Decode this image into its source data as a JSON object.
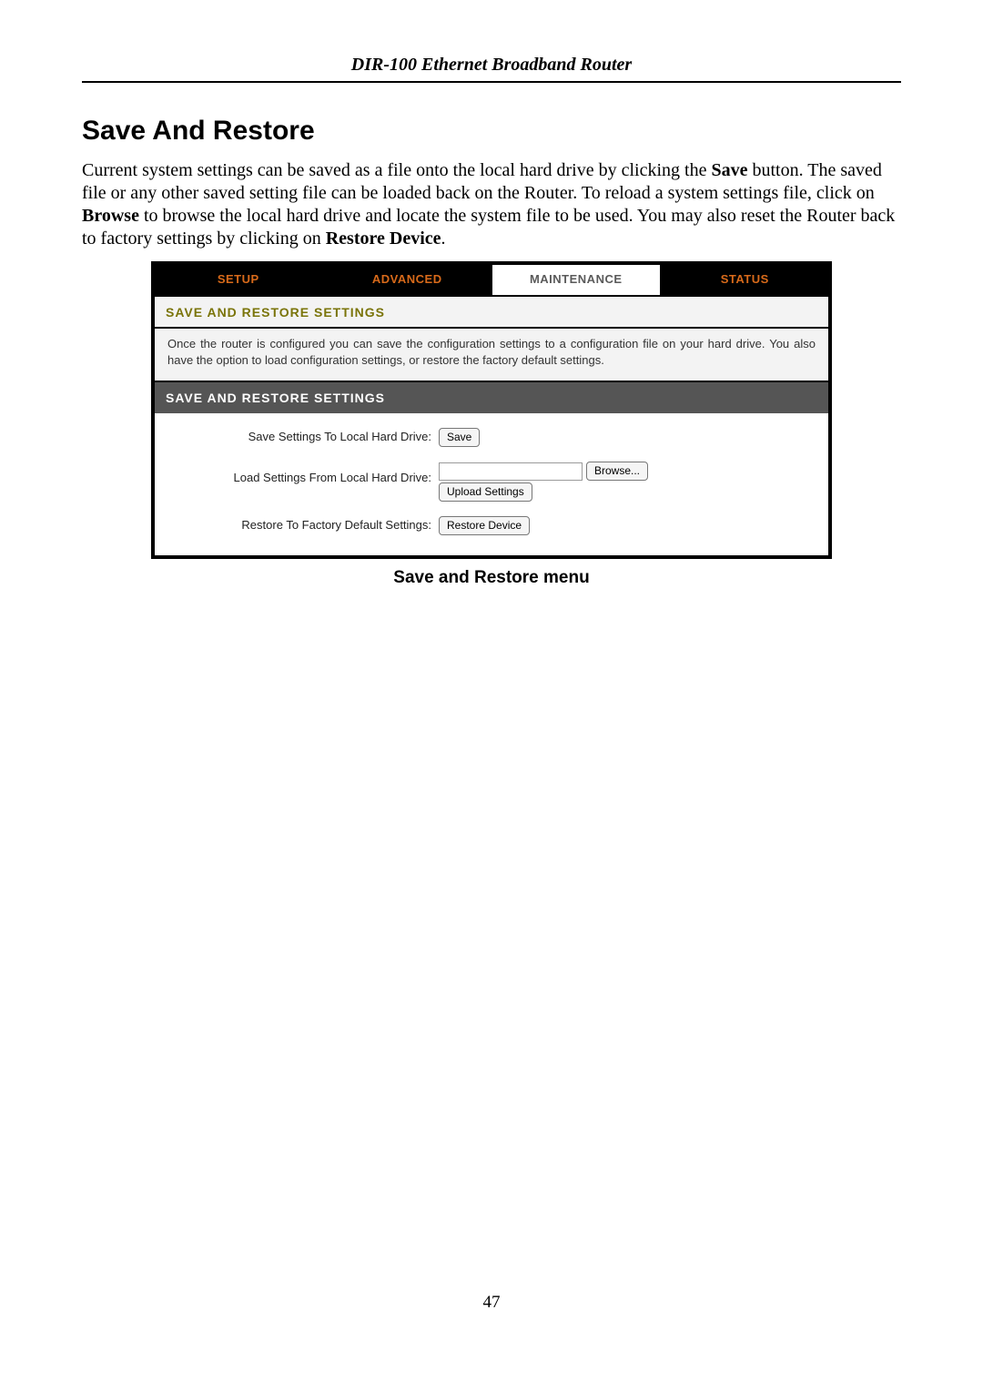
{
  "doc": {
    "header": "DIR-100 Ethernet Broadband Router",
    "section_title": "Save And Restore",
    "intro_parts": {
      "p1a": "Current system settings can be saved as a file onto the local hard drive by clicking the ",
      "p1b_bold": "Save",
      "p1c": " button. The saved file or any other saved setting file can be loaded back on the Router. To reload a system settings file, click on ",
      "p1d_bold": "Browse",
      "p1e": " to browse the local hard drive and locate the system file to be used. You may also reset the Router back to factory settings by clicking on ",
      "p1f_bold": "Restore Device",
      "p1g": "."
    },
    "caption": "Save and Restore menu",
    "page_number": "47"
  },
  "ui": {
    "tabs": {
      "setup": "SETUP",
      "advanced": "ADVANCED",
      "maintenance": "MAINTENANCE",
      "status": "STATUS"
    },
    "panel": {
      "title_light": "SAVE AND RESTORE SETTINGS",
      "description": "Once the router is configured you can save the configuration settings to a configuration file on your hard drive. You also have the option to load configuration settings, or restore the factory default settings.",
      "title_dark": "SAVE AND RESTORE SETTINGS"
    },
    "rows": {
      "save": {
        "label": "Save Settings To Local Hard Drive:",
        "button": "Save"
      },
      "load": {
        "label": "Load Settings From Local Hard Drive:",
        "browse_button": "Browse...",
        "upload_button": "Upload Settings"
      },
      "restore": {
        "label": "Restore To Factory Default Settings:",
        "button": "Restore Device"
      }
    }
  }
}
